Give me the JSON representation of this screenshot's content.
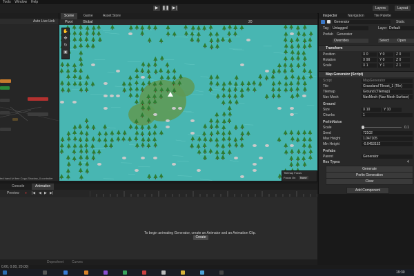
{
  "menubar": [
    "Tools",
    "Window",
    "Help"
  ],
  "toolbar": {
    "play": "▶",
    "pause": "❚❚",
    "step": "▶|",
    "layers": "Layers",
    "layout": "Layout"
  },
  "animator": {
    "tab": "Animator",
    "auto_live_link": "Auto Live Link",
    "footer": "ted hand lvl free Copy-Shadow_0.controller"
  },
  "scene": {
    "tabs": [
      "Scene",
      "Game",
      "Asset Store"
    ],
    "toolbar_left": [
      "Pivot",
      "Global"
    ],
    "toolbar_num": "20",
    "tilemap_focus_label": "Tilemap Focus",
    "focus_on_label": "Focus On",
    "focus_on_value": "None"
  },
  "inspector": {
    "tabs": [
      "Inspector",
      "Navigation",
      "Tile Palette"
    ],
    "object_name": "Generator",
    "static_label": "Static",
    "tag_label": "Tag",
    "tag_value": "Untagged",
    "layer_label": "Layer",
    "layer_value": "Default",
    "prefab_label": "Prefab",
    "prefab_value": "Generator",
    "overrides": "Overrides",
    "select": "Select",
    "open": "Open",
    "transform": {
      "title": "Transform",
      "position_label": "Position",
      "position": [
        "X 0",
        "Y 0",
        "Z 0"
      ],
      "rotation_label": "Rotation",
      "rotation": [
        "X 90",
        "Y 0",
        "Z 0"
      ],
      "scale_label": "Scale",
      "scale": [
        "X 1",
        "Y 1",
        "Z 1"
      ]
    },
    "map_generator": {
      "title": "Map Generator (Script)",
      "script_label": "Script",
      "script_value": "MapGenerator",
      "tile_label": "Tile",
      "tile_value": "Grassland Tileset_1 (Tile)",
      "tilemap_label": "Tilemap",
      "tilemap_value": "Ground (Tilemap)",
      "navmesh_label": "Nav Mesh",
      "navmesh_value": "NavMesh (Nav Mesh Surface)",
      "ground_label": "Ground",
      "size_label": "Size",
      "size": [
        "X 10",
        "Y 10"
      ],
      "chunks_label": "Chunks",
      "chunks_value": "1",
      "perlin_label": "PerlinNoise",
      "scale_label": "Scale",
      "scale_value": "0.1",
      "seed_label": "Seed",
      "seed_value": "72102",
      "maxheight_label": "Max Height",
      "maxheight_value": "1.047105",
      "minheight_label": "Min Height",
      "minheight_value": "-0.0453152",
      "prefabs_label": "Prefabs",
      "parent_label": "Parent",
      "parent_value": "Generator",
      "res_types_label": "Res Types",
      "res_types_value": "4"
    },
    "buttons": [
      "Generate",
      "Perlin Generation",
      "Clear"
    ],
    "add_component": "Add Component"
  },
  "bottom": {
    "tabs": [
      "Console",
      "Animation"
    ],
    "preview": "Preview",
    "message": "To begin animating Generator, create an Animator and an Animation Clip.",
    "create": "Create",
    "footer_tabs": [
      "Dopesheet",
      "Curves"
    ],
    "status": "0.00, 0.00, 20.00)"
  },
  "taskbar": {
    "time": "19:30"
  },
  "colors": {
    "water": "#48b6b2",
    "grass": "#5e9a55",
    "tree": "#2e7d32",
    "accent": "#3a78c9"
  }
}
